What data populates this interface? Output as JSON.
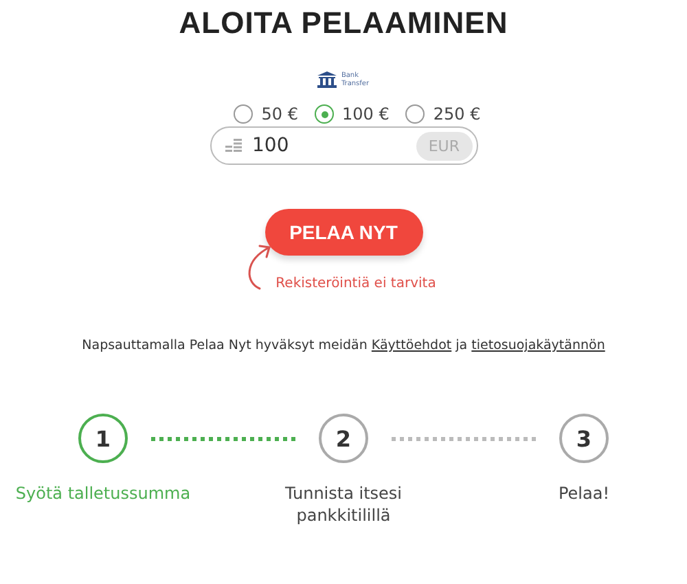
{
  "title": "ALOITA PELAAMINEN",
  "payment_method": {
    "label_line1": "Bank",
    "label_line2": "Transfer"
  },
  "amounts": [
    {
      "label": "50 €",
      "selected": false
    },
    {
      "label": "100 €",
      "selected": true
    },
    {
      "label": "250 €",
      "selected": false
    }
  ],
  "amount_field": {
    "value": "100",
    "currency": "EUR"
  },
  "play_button": "PELAA NYT",
  "note": "Rekisteröintiä ei tarvita",
  "terms": {
    "text": "Napsauttamalla Pelaa Nyt hyväksyt meidän",
    "link1": "Käyttöehdot",
    "joiner": "ja",
    "link2": "tietosuojakäytännön"
  },
  "steps": [
    {
      "number": "1",
      "label": "Syötä talletussumma",
      "selected": true
    },
    {
      "number": "2",
      "label": "Tunnista itsesi pankkitilillä",
      "selected": false
    },
    {
      "number": "3",
      "label": "Pelaa!",
      "selected": false
    }
  ]
}
